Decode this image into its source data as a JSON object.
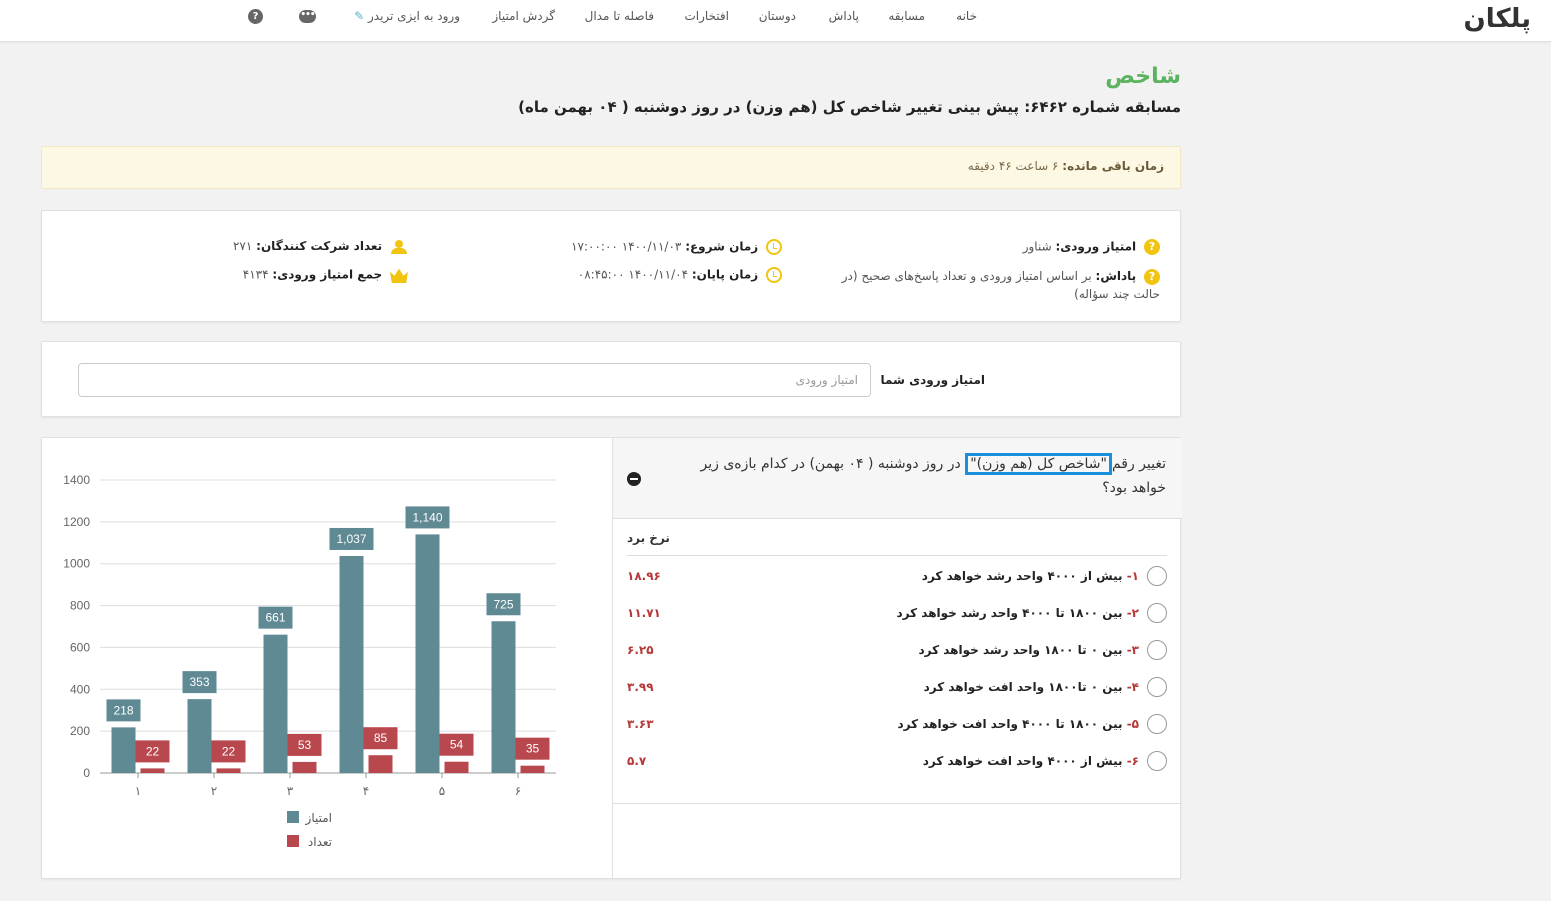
{
  "nav": {
    "logo": "پلکان",
    "items": [
      {
        "label": "خانه",
        "name": "nav-item-home"
      },
      {
        "label": "مسابقه",
        "name": "nav-item-contest"
      },
      {
        "label": "پاداش",
        "name": "nav-item-reward"
      },
      {
        "label": "دوستان",
        "name": "nav-item-friends"
      },
      {
        "label": "افتخارات",
        "name": "nav-item-honors"
      },
      {
        "label": "فاصله تا مدال",
        "name": "nav-item-medal-distance"
      },
      {
        "label": "گردش امتیاز",
        "name": "nav-item-score-turnover"
      },
      {
        "label": "ورود به ایزی تریدر",
        "name": "nav-item-easytrader"
      }
    ]
  },
  "page": {
    "title": "شاخص",
    "subtitle": "مسابقه شماره ۶۴۶۲: پیش بینی تغییر شاخص کل (هم وزن) در روز دوشنبه ( ۰۴ بهمن ماه)"
  },
  "alert": {
    "label": "زمان باقی مانده:",
    "value": "۶ ساعت ۴۶ دقیقه"
  },
  "info": {
    "entry_score_label": "امتیاز ورودی:",
    "entry_score_value": "شناور",
    "reward_label": "پاداش:",
    "reward_value": "بر اساس امتیاز ورودی و تعداد پاسخ‌های صحیح (در حالت چند سؤاله)",
    "start_label": "زمان شروع:",
    "start_value": "۱۴۰۰/۱۱/۰۳ ۱۷:۰۰:۰۰",
    "end_label": "زمان پایان:",
    "end_value": "۱۴۰۰/۱۱/۰۴ ۰۸:۴۵:۰۰",
    "participants_label": "تعداد شرکت کنندگان:",
    "participants_value": "۲۷۱",
    "total_score_label": "جمع امتیاز ورودی:",
    "total_score_value": "۴۱۳۴"
  },
  "entry": {
    "label": "امتیاز ورودی شما",
    "placeholder": "امتیاز ورودی"
  },
  "question": {
    "text_before": "تغییر رقم",
    "highlight": "\"شاخص کل (هم وزن)\"",
    "text_after": "در روز دوشنبه ( ۰۴ بهمن) در کدام بازه‌ی زیر خواهد بود؟",
    "rate_header": "نرخ برد",
    "options": [
      {
        "num": "۱-",
        "label": "بیش از ۴۰۰۰ واحد رشد خواهد کرد",
        "rate": "۱۸.۹۶"
      },
      {
        "num": "۲-",
        "label": "بین ۱۸۰۰ تا ۴۰۰۰ واحد رشد خواهد کرد",
        "rate": "۱۱.۷۱"
      },
      {
        "num": "۳-",
        "label": "بین ۰ تا ۱۸۰۰ واحد رشد خواهد کرد",
        "rate": "۶.۲۵"
      },
      {
        "num": "۴-",
        "label": "بین ۰ تا۱۸۰۰ واحد افت خواهد کرد",
        "rate": "۳.۹۹"
      },
      {
        "num": "۵-",
        "label": "بین ۱۸۰۰ تا ۴۰۰۰ واحد افت خواهد کرد",
        "rate": "۳.۶۳"
      },
      {
        "num": "۶-",
        "label": "بیش از ۴۰۰۰ واحد افت خواهد کرد",
        "rate": "۵.۷"
      }
    ]
  },
  "chart_data": {
    "type": "bar",
    "categories": [
      "۱",
      "۲",
      "۳",
      "۴",
      "۵",
      "۶"
    ],
    "series": [
      {
        "name": "امتیاز",
        "values": [
          218,
          353,
          661,
          1037,
          1140,
          725
        ],
        "labels": [
          "218",
          "353",
          "661",
          "1,037",
          "1,140",
          "725"
        ],
        "color": "#5f8a94"
      },
      {
        "name": "تعداد",
        "values": [
          22,
          22,
          53,
          85,
          54,
          35
        ],
        "labels": [
          "22",
          "22",
          "53",
          "85",
          "54",
          "35"
        ],
        "color": "#b9484e"
      }
    ],
    "yticks": [
      0,
      200,
      400,
      600,
      800,
      1000,
      1200,
      1400
    ],
    "ylim": [
      0,
      1400
    ],
    "grid": true,
    "legend": "bottom"
  },
  "colors": {
    "accent_green": "#5bb35f",
    "icon_yellow": "#f1c40f",
    "rate_red": "#b63838",
    "highlight_blue": "#1a8fe0"
  }
}
